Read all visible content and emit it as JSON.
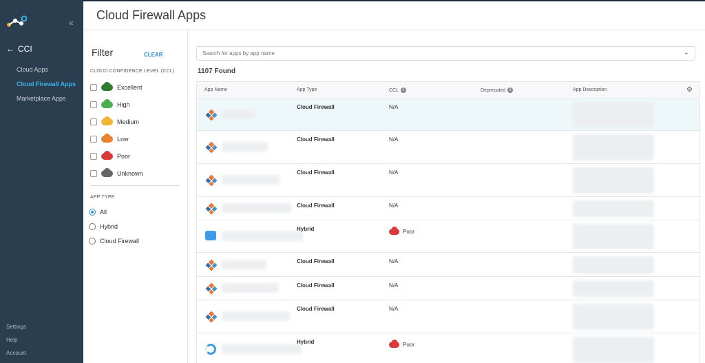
{
  "sidebar": {
    "back_label": "CCI",
    "items": [
      {
        "label": "Cloud Apps",
        "active": false
      },
      {
        "label": "Cloud Firewall Apps",
        "active": true
      },
      {
        "label": "Marketplace Apps",
        "active": false
      }
    ],
    "bottom": [
      "Settings",
      "Help",
      "Account"
    ]
  },
  "header": {
    "title": "Cloud Firewall Apps"
  },
  "filter": {
    "title": "Filter",
    "clear_label": "CLEAR",
    "ccl_title": "CLOUD CONFIDENCE LEVEL (CCL)",
    "ccl_levels": [
      {
        "label": "Excellent",
        "color": "#2e7d32"
      },
      {
        "label": "High",
        "color": "#4caf50"
      },
      {
        "label": "Medium",
        "color": "#f2b632"
      },
      {
        "label": "Low",
        "color": "#e8832f"
      },
      {
        "label": "Poor",
        "color": "#d93a3a"
      },
      {
        "label": "Unknown",
        "color": "#666666"
      }
    ],
    "type_title": "APP TYPE",
    "types": [
      {
        "label": "All",
        "checked": true
      },
      {
        "label": "Hybrid",
        "checked": false
      },
      {
        "label": "Cloud Firewall",
        "checked": false
      }
    ]
  },
  "search": {
    "placeholder": "Search for apps by app name"
  },
  "found": "1107 Found",
  "table": {
    "columns": [
      "App Name",
      "App Type",
      "CCL",
      "Deprecated",
      "App Description"
    ],
    "rows": [
      {
        "type": "Cloud Firewall",
        "ccl": "N/A",
        "icon": "diamond",
        "highlight": true
      },
      {
        "type": "Cloud Firewall",
        "ccl": "N/A",
        "icon": "diamond",
        "highlight": false
      },
      {
        "type": "Cloud Firewall",
        "ccl": "N/A",
        "icon": "diamond",
        "highlight": false
      },
      {
        "type": "Cloud Firewall",
        "ccl": "N/A",
        "icon": "diamond",
        "highlight": false
      },
      {
        "type": "Hybrid",
        "ccl": "Poor",
        "icon": "hybrid",
        "highlight": false
      },
      {
        "type": "Cloud Firewall",
        "ccl": "N/A",
        "icon": "diamond",
        "highlight": false
      },
      {
        "type": "Cloud Firewall",
        "ccl": "N/A",
        "icon": "diamond",
        "highlight": false
      },
      {
        "type": "Cloud Firewall",
        "ccl": "N/A",
        "icon": "diamond",
        "highlight": false
      },
      {
        "type": "Hybrid",
        "ccl": "Poor",
        "icon": "hybrid2",
        "highlight": false
      }
    ]
  },
  "colors": {
    "accent": "#39b4e8",
    "sidebar": "#2b3e50",
    "poor": "#d93a3a"
  }
}
